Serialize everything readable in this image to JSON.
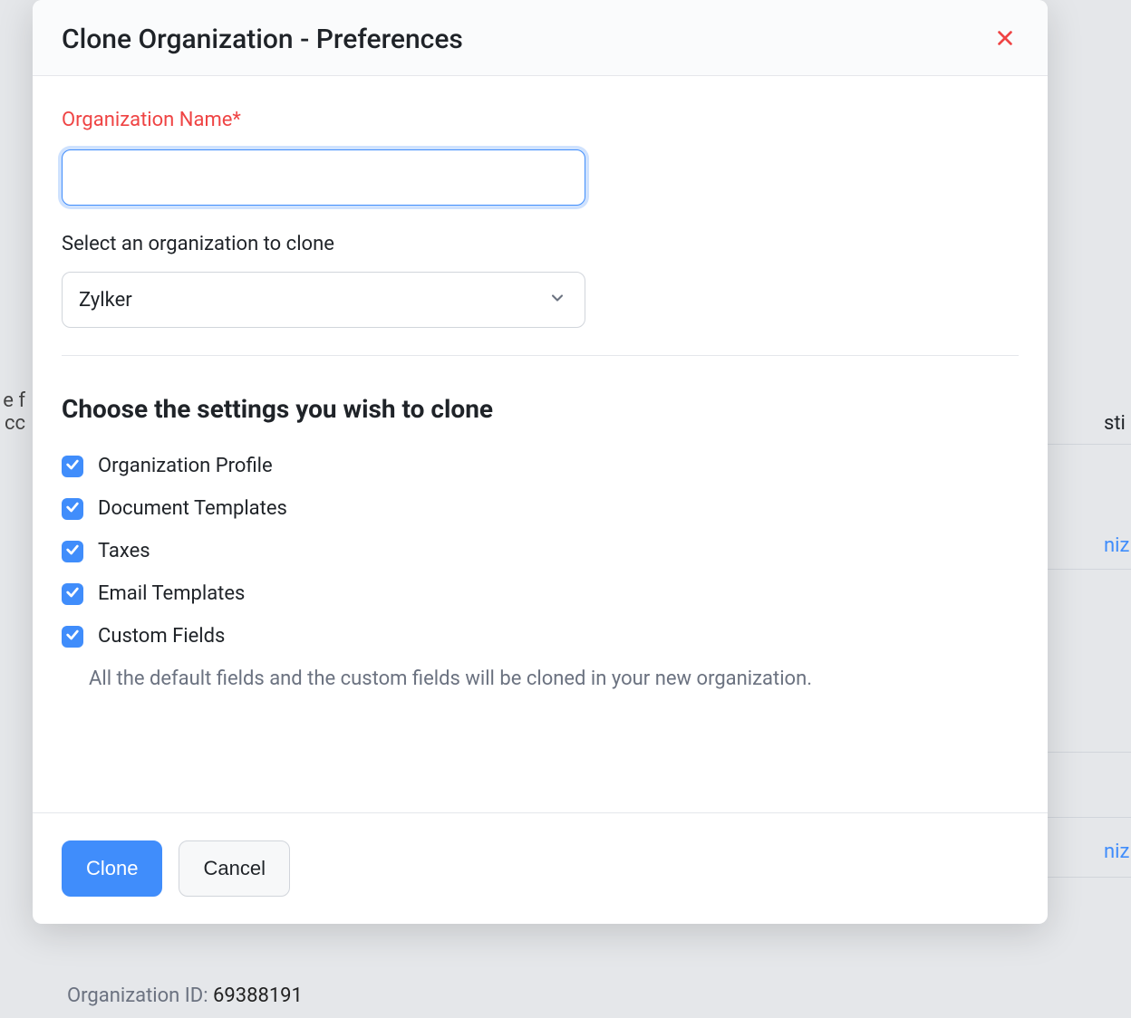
{
  "modal": {
    "title": "Clone Organization - Preferences",
    "org_name_label": "Organization Name*",
    "org_name_value": "",
    "select_label": "Select an organization to clone",
    "select_value": "Zylker",
    "section_heading": "Choose the settings you wish to clone",
    "options": [
      {
        "label": "Organization Profile",
        "checked": true
      },
      {
        "label": "Document Templates",
        "checked": true
      },
      {
        "label": "Taxes",
        "checked": true
      },
      {
        "label": "Email Templates",
        "checked": true
      },
      {
        "label": "Custom Fields",
        "checked": true
      }
    ],
    "helper_text": "All the default fields and the custom fields will be cloned in your new organization.",
    "clone_label": "Clone",
    "cancel_label": "Cancel"
  },
  "background": {
    "left_fragment": "e f\ncc",
    "right_fragment_1": "sti",
    "right_fragment_2": "niz",
    "right_fragment_3": "niz",
    "org_id_label": "Organization ID: ",
    "org_id_value": "69388191"
  }
}
